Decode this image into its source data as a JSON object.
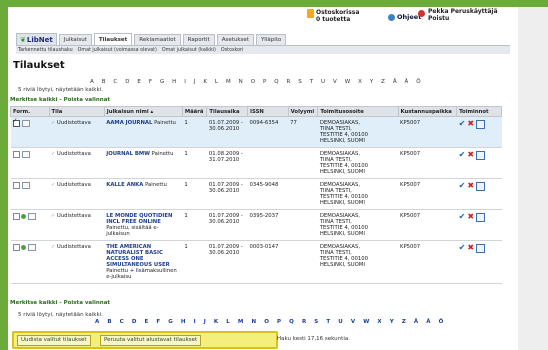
{
  "header": {
    "cart_title": "Ostoskorissa",
    "cart_count": "0 tuotetta",
    "help": "Ohjeet",
    "user_name": "Pekka Peruskäyttäjä",
    "logout": "Poistu"
  },
  "tabs": {
    "logo": "LibNet",
    "items": [
      "Julkaisut",
      "Tilaukset",
      "Reklamaatiot",
      "Raportit",
      "Asetukset",
      "Ylläpito"
    ]
  },
  "subnav": [
    "Tarkennettu tilaushaku",
    "Omat julkaisut (voimassa olevat)",
    "Omat julkaisut (kaikki)",
    "Ostoskori"
  ],
  "page": {
    "title": "Tilaukset",
    "alphabet": "A B C D E F G H I J K L M N O P Q R S T U V W X Y Z Å Ä Ö",
    "count_text": "5 riviä löytyi, näytetään kaikki.",
    "mark_all": "Merkitse kaikki",
    "remove_marks": "Poista valinnat"
  },
  "table": {
    "headers": [
      "Form.",
      "Tila",
      "Julkaisun nimi",
      "Määrä",
      "Tilausaika",
      "ISSN",
      "Volyymi",
      "Toimitusosoite",
      "Kustannuspaikka",
      "Toiminnot"
    ],
    "rows": [
      {
        "tila": "Uudistettava",
        "name": "AAMA JOURNAL",
        "detail": "Painettu",
        "qty": "1",
        "time1": "01.07.2009 -",
        "time2": "30.06.2010",
        "issn": "0094-6354",
        "vol": "77",
        "addr1": "DEMOASIAKAS,",
        "addr2": "TIINA TESTI,",
        "addr3": "TESTITIE 4, 00100",
        "addr4": "HELSINKI, SUOMI",
        "cost": "KP5007"
      },
      {
        "tila": "Uudistettava",
        "name": "JOURNAL BMW",
        "detail": "Painettu",
        "qty": "1",
        "time1": "01.08.2009 -",
        "time2": "31.07.2010",
        "issn": "",
        "vol": "",
        "addr1": "DEMOASIAKAS,",
        "addr2": "TIINA TESTI,",
        "addr3": "TESTITIE 4, 00100",
        "addr4": "HELSINKI, SUOMI",
        "cost": "KP5007"
      },
      {
        "tila": "Uudistettava",
        "name": "KALLE ANKA",
        "detail": "Painettu",
        "qty": "1",
        "time1": "01.07.2009 -",
        "time2": "30.06.2010",
        "issn": "0345-9048",
        "vol": "",
        "addr1": "DEMOASIAKAS,",
        "addr2": "TIINA TESTI,",
        "addr3": "TESTITIE 4, 00100",
        "addr4": "HELSINKI, SUOMI",
        "cost": "KP5007"
      },
      {
        "tila": "Uudistettava",
        "name": "LE MONDE QUOTIDIEN INCL FREE ONLINE",
        "detail": "Painettu, sisältää e-julkaisun",
        "qty": "1",
        "time1": "01.07.2009 -",
        "time2": "30.06.2010",
        "issn": "0395-2037",
        "vol": "",
        "addr1": "DEMOASIAKAS,",
        "addr2": "TIINA TESTI,",
        "addr3": "TESTITIE 4, 00100",
        "addr4": "HELSINKI, SUOMI",
        "cost": "KP5007"
      },
      {
        "tila": "Uudistettava",
        "name": "THE AMERICAN NATURALIST BASIC ACCESS ONE SIMULTANEOUS USER",
        "detail": "Painettu + lisämaksullinen e-julkaisu",
        "qty": "1",
        "time1": "01.07.2009 -",
        "time2": "30.06.2010",
        "issn": "0003-0147",
        "vol": "",
        "addr1": "DEMOASIAKAS,",
        "addr2": "TIINA TESTI,",
        "addr3": "TESTITIE 4, 00100",
        "addr4": "HELSINKI, SUOMI",
        "cost": "KP5007"
      }
    ]
  },
  "footer": {
    "btn_renew": "Uudista valitut tilaukset",
    "btn_cancel": "Peruuta valitut alustavat tilaukset",
    "search_time": "Haku kesti 17,16 sekuntia."
  },
  "colors": {
    "accent": "#6bab3a",
    "link": "#1d3c8c",
    "highlight": "#f4ef7a"
  }
}
